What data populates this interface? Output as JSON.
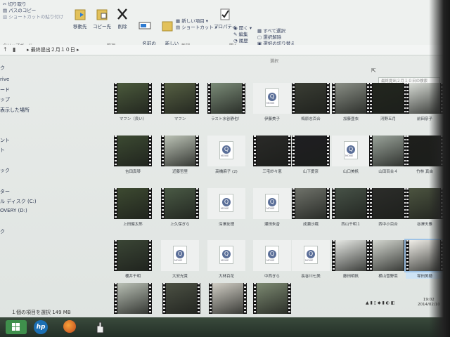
{
  "ribbon": {
    "clipboard": {
      "cut": "切り取り",
      "copy_path": "パスのコピー",
      "paste_shortcut": "ショートカットの貼り付け",
      "group": "クリップボード"
    },
    "organize": {
      "move_to": "移動先",
      "copy_to": "コピー先",
      "delete": "削除",
      "rename": "名前の\n変更",
      "group": "整理"
    },
    "new": {
      "new_folder": "新しい\nフォルダー",
      "new_item": "新しい項目 ▾",
      "easy_access": "ショートカット ▾",
      "group": "新規"
    },
    "open": {
      "properties": "プロパティ",
      "open": "開く ▾",
      "edit": "編集",
      "history": "履歴",
      "group": "開く"
    },
    "select": {
      "select_all": "すべて選択",
      "select_none": "選択解除",
      "invert": "選択の切り替え",
      "group": "選択"
    }
  },
  "address": {
    "back": "←",
    "forward": "→",
    "up": "↑",
    "path": "▸ 最終提出２月１０日 ▸",
    "search_placeholder": "最終提出２月１０日の検索"
  },
  "nav": {
    "items": [
      "ク",
      "rive",
      "ード",
      "ップ",
      "表示した場所",
      "ント",
      "ト",
      "ック",
      "ター",
      "ル ディスク (C:)",
      "OVERY (D:)",
      "ク"
    ]
  },
  "files": [
    {
      "label": "マフン（良い）",
      "type": "video",
      "tone": "#4b5a3c"
    },
    {
      "label": "マフン",
      "type": "video",
      "tone": "#566043"
    },
    {
      "label": "ラスト水谷静也！",
      "type": "video",
      "tone": "#7b8c78"
    },
    {
      "label": "伊藤美子",
      "type": "doc"
    },
    {
      "label": "梅原志百合",
      "type": "video",
      "tone": "#3a3d34"
    },
    {
      "label": "加藤亜衣",
      "type": "video",
      "tone": "#8a8f86"
    },
    {
      "label": "河野五月",
      "type": "video",
      "tone": "#23271f"
    },
    {
      "label": "前田奈子",
      "type": "video",
      "tone": "#d8dcd6"
    },
    {
      "label": "吉田真琴",
      "type": "video",
      "tone": "#3c4a32"
    },
    {
      "label": "近藤哲里",
      "type": "video",
      "tone": "#bcc3b6"
    },
    {
      "label": "高橋麻子 (2)",
      "type": "doc"
    },
    {
      "label": "三宅紗々恵",
      "type": "video",
      "tone": "#2a2a28"
    },
    {
      "label": "山下愛奈",
      "type": "video",
      "tone": "#1f1f22"
    },
    {
      "label": "山口美帆",
      "type": "doc"
    },
    {
      "label": "山田百合４",
      "type": "video",
      "tone": "#9aa39a"
    },
    {
      "label": "竹林 真由",
      "type": "video",
      "tone": "#1e1f1c"
    },
    {
      "label": "上田健太郎",
      "type": "video",
      "tone": "#3d4a31"
    },
    {
      "label": "上久保ぎら",
      "type": "video",
      "tone": "#4a5a45"
    },
    {
      "label": "深澤友理",
      "type": "doc"
    },
    {
      "label": "瀬田朱音",
      "type": "doc"
    },
    {
      "label": "成瀬沙織",
      "type": "video",
      "tone": "#6f726a"
    },
    {
      "label": "西山千明１",
      "type": "video",
      "tone": "#475247"
    },
    {
      "label": "西中小百合",
      "type": "video",
      "tone": "#2c2d2a"
    },
    {
      "label": "谷澤天雅",
      "type": "video",
      "tone": "#4c5440"
    },
    {
      "label": "櫻井千明",
      "type": "video",
      "tone": "#3a4535"
    },
    {
      "label": "大安光貴",
      "type": "doc"
    },
    {
      "label": "大林百花",
      "type": "doc"
    },
    {
      "label": "中西ぎら",
      "type": "doc"
    },
    {
      "label": "長谷川七美",
      "type": "doc"
    },
    {
      "label": "藤田明帆",
      "type": "video",
      "tone": "#e6e8e4"
    },
    {
      "label": "横山雪野菜",
      "type": "video",
      "tone": "#d3d6cf"
    },
    {
      "label": "塚田美穂",
      "type": "video",
      "tone": "#f0eee8",
      "selected": true
    },
    {
      "label": "",
      "type": "video",
      "tone": "#b9c0b5"
    },
    {
      "label": "",
      "type": "video",
      "tone": "#4c5144"
    },
    {
      "label": "",
      "type": "video",
      "tone": "#d2cfc6"
    },
    {
      "label": "",
      "type": "video",
      "tone": "#7d8a72"
    }
  ],
  "status": {
    "text": "１個の項目を選択  149 MB"
  },
  "tray": {
    "icons": "▲ ▮ ▯ ◆ ▮ ◐ ◧",
    "time": "19:02",
    "date": "2014/02/10"
  },
  "taskbar": {
    "start_color": "#3f8f4c",
    "hp_label": "hp"
  }
}
